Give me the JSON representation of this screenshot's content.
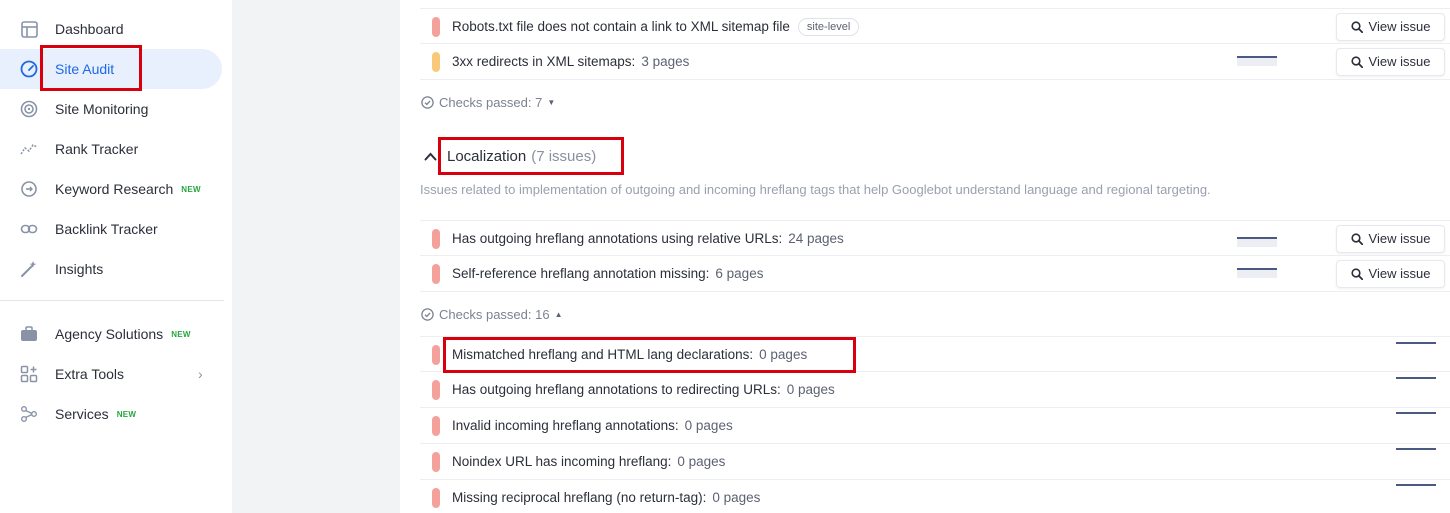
{
  "sidebar": {
    "items": [
      {
        "label": "Dashboard",
        "icon": "dashboard-icon",
        "new": false,
        "active": false
      },
      {
        "label": "Site Audit",
        "icon": "speedometer-icon",
        "new": false,
        "active": true
      },
      {
        "label": "Site Monitoring",
        "icon": "monitoring-icon",
        "new": false,
        "active": false
      },
      {
        "label": "Rank Tracker",
        "icon": "rank-tracker-icon",
        "new": false,
        "active": false
      },
      {
        "label": "Keyword Research",
        "icon": "keyword-research-icon",
        "new": true,
        "active": false
      },
      {
        "label": "Backlink Tracker",
        "icon": "link-icon",
        "new": false,
        "active": false
      },
      {
        "label": "Insights",
        "icon": "magic-wand-icon",
        "new": false,
        "active": false
      },
      {
        "label": "Agency Solutions",
        "icon": "briefcase-icon",
        "new": true,
        "active": false
      },
      {
        "label": "Extra Tools",
        "icon": "apps-icon",
        "new": false,
        "active": false
      },
      {
        "label": "Services",
        "icon": "services-icon",
        "new": true,
        "active": false
      }
    ],
    "new_badge": "NEW"
  },
  "top_rows": [
    {
      "text": "Robots.txt file does not contain a link to XML sitemap file",
      "tag": "site-level",
      "count": "",
      "severity": "error",
      "button": "View issue"
    },
    {
      "text": "3xx redirects in XML sitemaps:",
      "tag": "",
      "count": "3 pages",
      "severity": "warning",
      "button": "View issue"
    }
  ],
  "checks_passed_top": "Checks passed: 7",
  "localization": {
    "title": "Localization",
    "count": "(7 issues)",
    "description": "Issues related to implementation of outgoing and incoming hreflang tags that help Googlebot understand language and regional targeting.",
    "issues": [
      {
        "text": "Has outgoing hreflang annotations using relative URLs:",
        "count": "24 pages",
        "button": "View issue"
      },
      {
        "text": "Self-reference hreflang annotation missing:",
        "count": "6 pages",
        "button": "View issue"
      }
    ],
    "checks_passed": "Checks passed: 16",
    "passed": [
      {
        "text": "Mismatched hreflang and HTML lang declarations:",
        "count": "0 pages"
      },
      {
        "text": "Has outgoing hreflang annotations to redirecting URLs:",
        "count": "0 pages"
      },
      {
        "text": "Invalid incoming hreflang annotations:",
        "count": "0 pages"
      },
      {
        "text": "Noindex URL has incoming hreflang:",
        "count": "0 pages"
      },
      {
        "text": "Missing reciprocal hreflang (no return-tag):",
        "count": "0 pages"
      }
    ]
  },
  "colors": {
    "accent": "#1d6ae5",
    "error": "#f5a19b",
    "warning": "#f8c97a",
    "new_badge": "#26a541",
    "highlight": "#d9000d"
  }
}
